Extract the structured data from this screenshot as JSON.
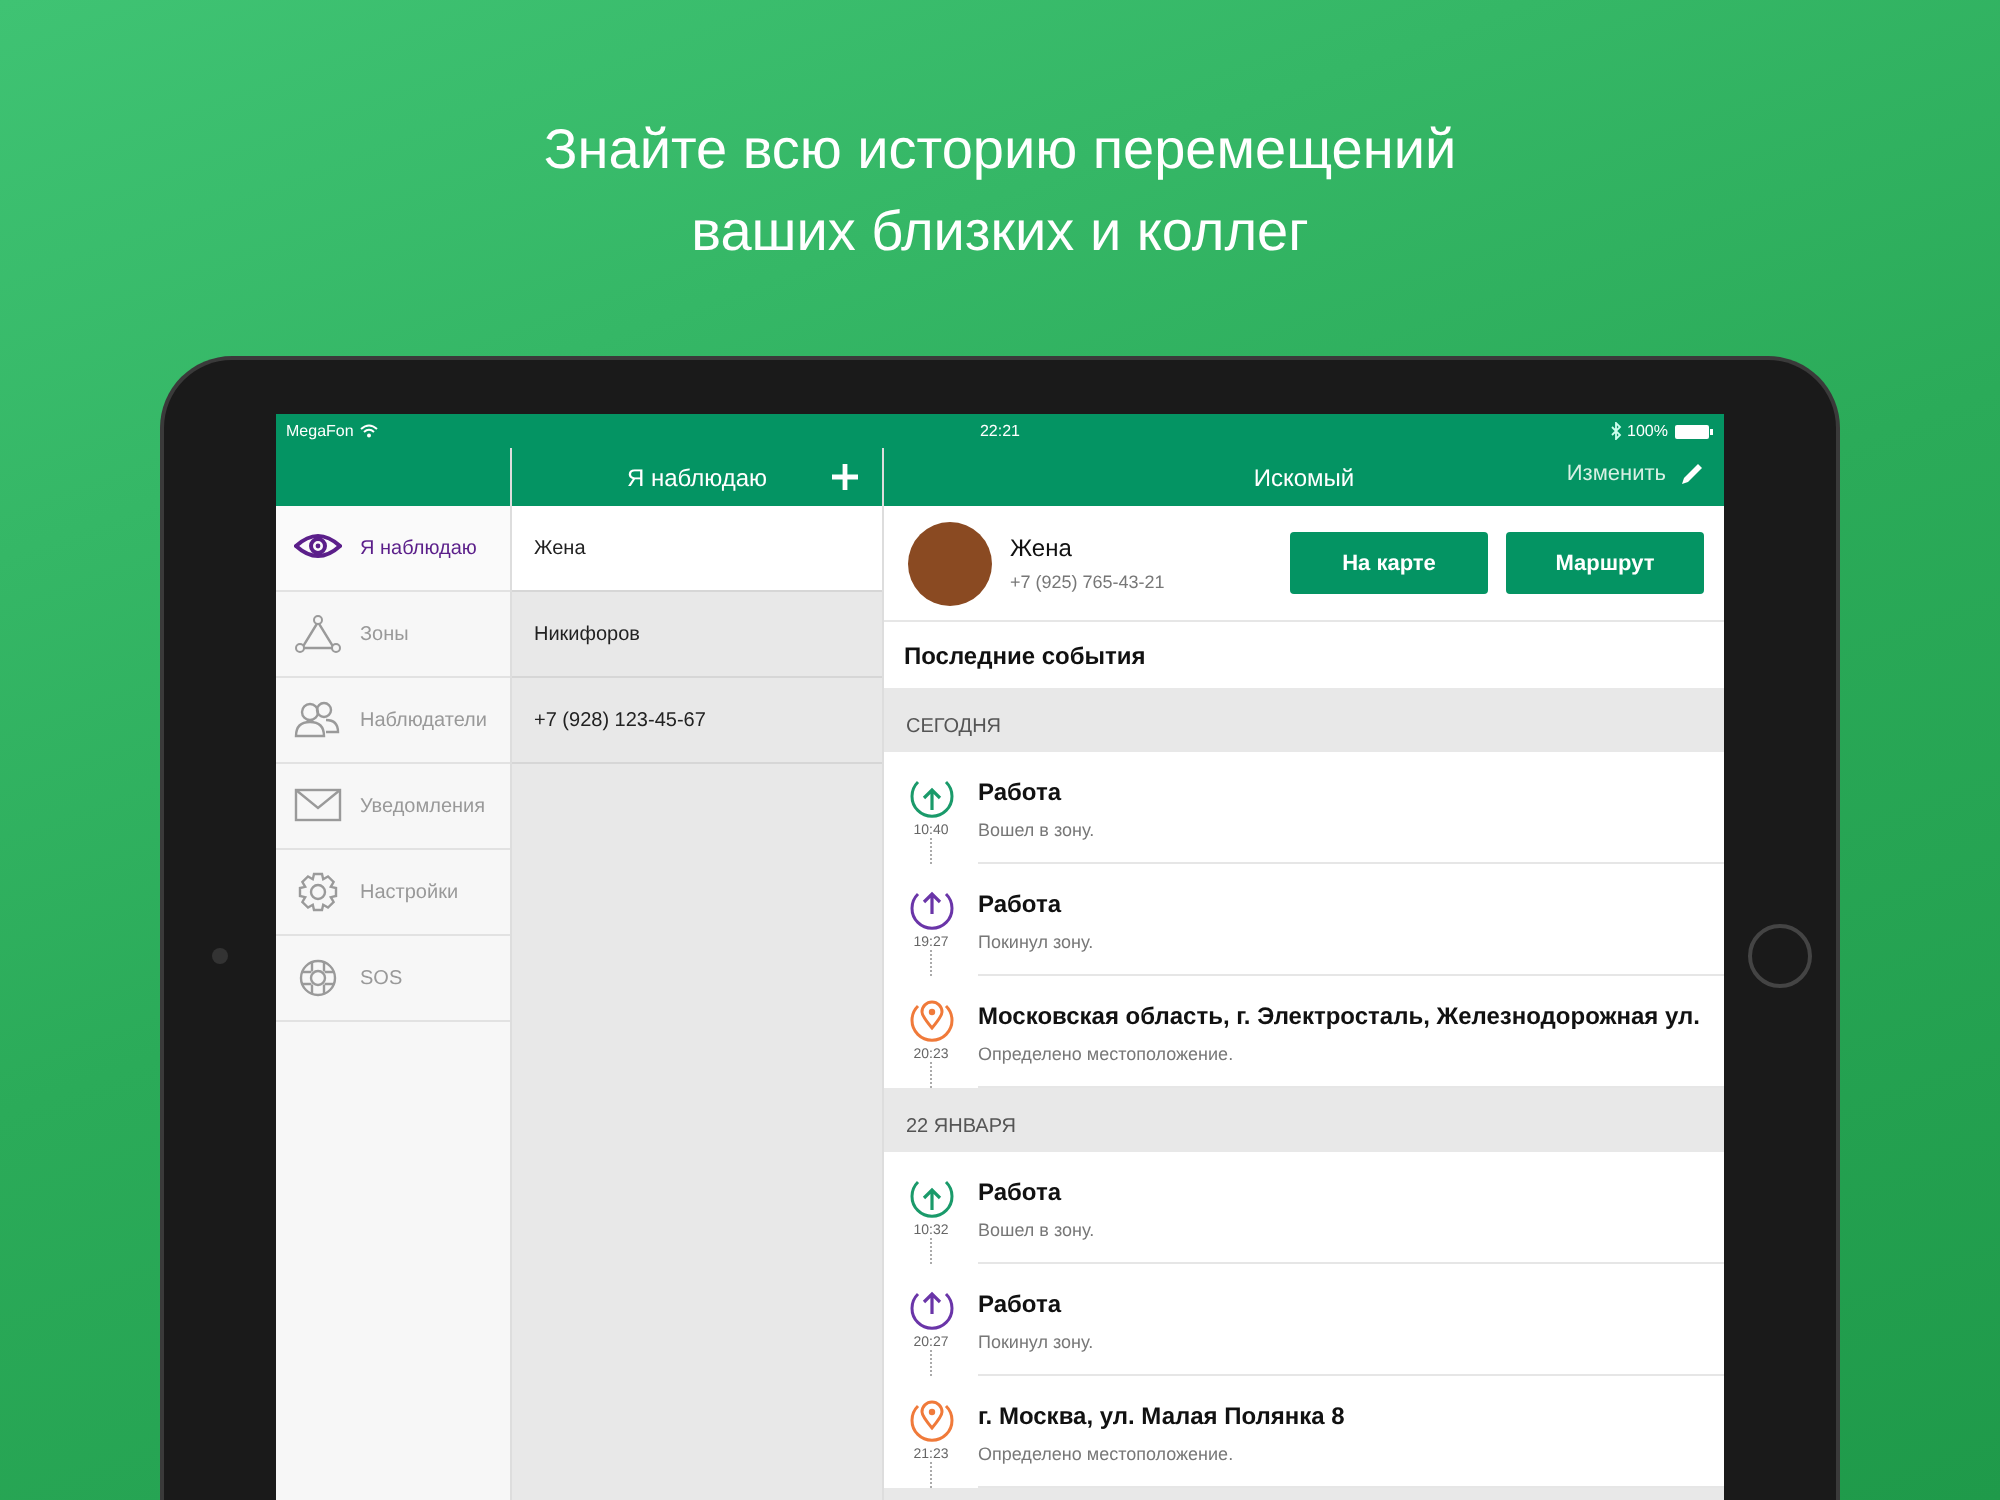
{
  "headline": [
    "Знайте всю историю перемещений",
    "ваших близких и коллег"
  ],
  "status_bar": {
    "carrier": "MegaFon",
    "time": "22:21",
    "battery": "100%"
  },
  "sidebar": {
    "items": [
      {
        "kind": "eye",
        "label": "Я наблюдаю",
        "selected": true
      },
      {
        "kind": "zones",
        "label": "Зоны",
        "selected": false
      },
      {
        "kind": "people",
        "label": "Наблюдатели",
        "selected": false
      },
      {
        "kind": "mail",
        "label": "Уведомления",
        "selected": false
      },
      {
        "kind": "gear",
        "label": "Настройки",
        "selected": false
      },
      {
        "kind": "sos",
        "label": "SOS",
        "selected": false
      }
    ]
  },
  "list": {
    "title": "Я наблюдаю",
    "items": [
      {
        "label": "Жена",
        "selected": true
      },
      {
        "label": "Никифоров",
        "selected": false
      },
      {
        "label": "+7 (928) 123-45-67",
        "selected": false
      }
    ]
  },
  "detail": {
    "title": "Искомый",
    "edit_button": "Изменить",
    "profile": {
      "name": "Жена",
      "phone": "+7 (925) 765-43-21"
    },
    "buttons": [
      "На карте",
      "Маршрут"
    ],
    "events_title": "Последние события",
    "sections": [
      {
        "header": "СЕГОДНЯ",
        "events": [
          {
            "kind": "enter",
            "time": "10:40",
            "title": "Работа",
            "subtitle": "Вошел в зону."
          },
          {
            "kind": "leave",
            "time": "19:27",
            "title": "Работа",
            "subtitle": "Покинул зону."
          },
          {
            "kind": "location",
            "time": "20:23",
            "title": "Московская область, г. Электросталь, Железнодорожная ул.",
            "subtitle": "Определено местоположение."
          }
        ]
      },
      {
        "header": "22 ЯНВАРЯ",
        "events": [
          {
            "kind": "enter",
            "time": "10:32",
            "title": "Работа",
            "subtitle": "Вошел в зону."
          },
          {
            "kind": "leave",
            "time": "20:27",
            "title": "Работа",
            "subtitle": "Покинул зону."
          },
          {
            "kind": "location",
            "time": "21:23",
            "title": "г. Москва, ул. Малая Полянка 8",
            "subtitle": "Определено местоположение."
          }
        ]
      }
    ]
  }
}
